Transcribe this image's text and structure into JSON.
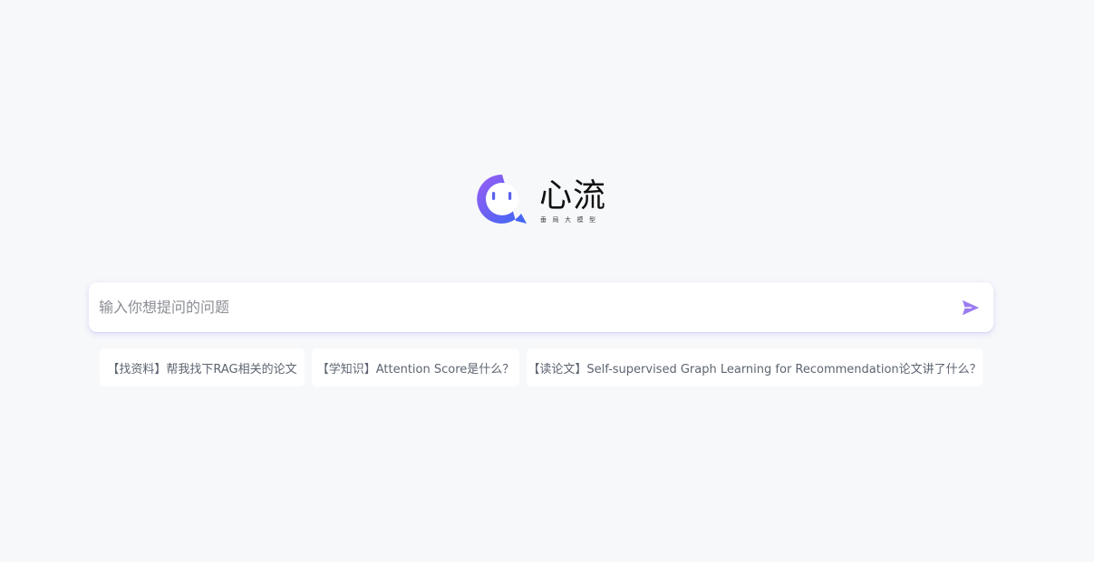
{
  "brand": {
    "title": "心流",
    "subtitle": "垂局大模型",
    "logo_icon": "chat-bubble-face-icon",
    "gradient_start": "#8b5cf6",
    "gradient_end": "#3b6ff5"
  },
  "search": {
    "placeholder": "输入你想提问的问题",
    "value": "",
    "send_icon": "send-icon",
    "send_color": "#9b7cf0"
  },
  "suggestions": [
    {
      "label": "【找资料】帮我找下RAG相关的论文"
    },
    {
      "label": "【学知识】Attention Score是什么？"
    },
    {
      "label": "【读论文】Self-supervised Graph Learning for Recommendation论文讲了什么？"
    }
  ]
}
